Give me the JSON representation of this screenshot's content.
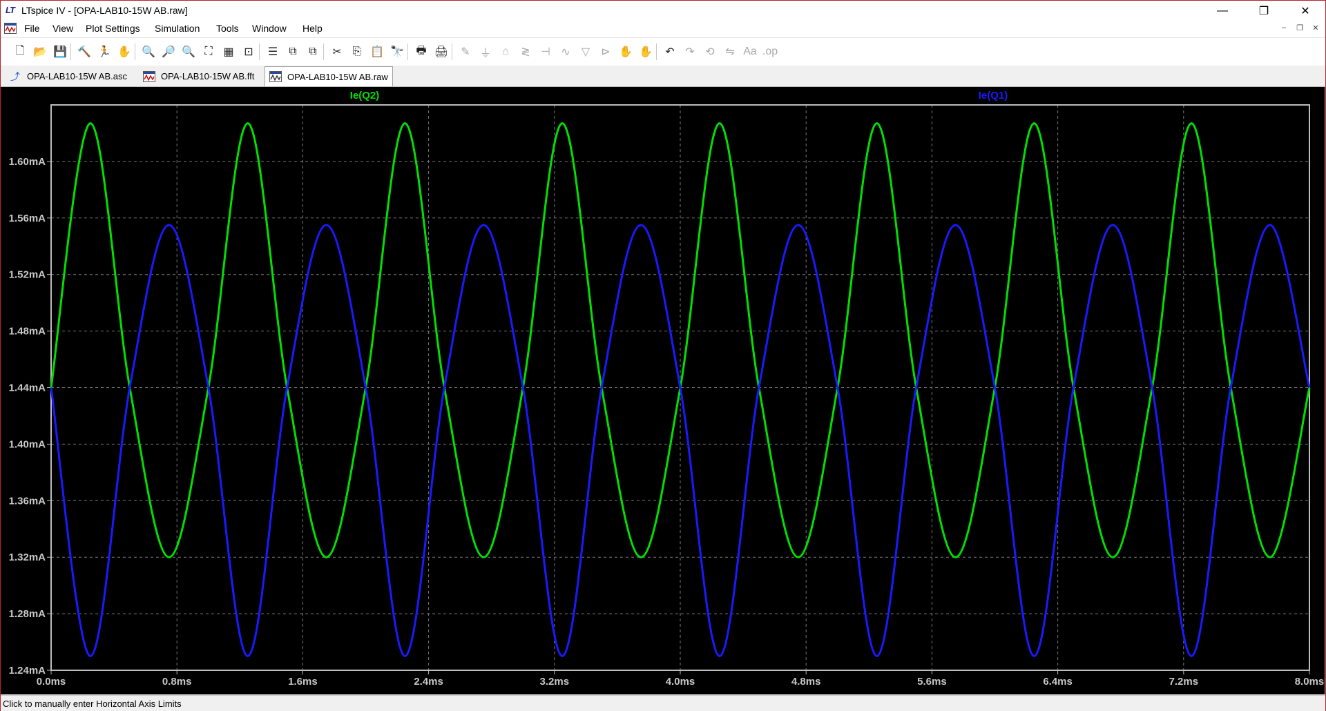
{
  "window": {
    "app_mark": "LT",
    "title": "LTspice IV - [OPA-LAB10-15W AB.raw]",
    "minimize": "—",
    "maximize": "❐",
    "close": "✕"
  },
  "menu": {
    "items": [
      "File",
      "View",
      "Plot Settings",
      "Simulation",
      "Tools",
      "Window",
      "Help"
    ],
    "mdi_minimize": "–",
    "mdi_restore": "❐",
    "mdi_close": "✕"
  },
  "toolbar": {
    "buttons": [
      {
        "name": "new-schematic-icon",
        "glyph": "🗋",
        "enabled": true
      },
      {
        "name": "open-icon",
        "glyph": "📂",
        "enabled": true
      },
      {
        "name": "save-icon",
        "glyph": "💾",
        "enabled": true
      },
      {
        "name": "control-panel-icon",
        "glyph": "🔨",
        "enabled": true
      },
      {
        "name": "run-icon",
        "glyph": "🏃",
        "enabled": true
      },
      {
        "name": "pan-icon",
        "glyph": "✋",
        "enabled": false
      },
      {
        "name": "zoom-in-icon",
        "glyph": "🔍",
        "enabled": true
      },
      {
        "name": "zoom-area-icon",
        "glyph": "🔎",
        "enabled": true
      },
      {
        "name": "zoom-out-icon",
        "glyph": "🔍",
        "enabled": true
      },
      {
        "name": "zoom-fit-icon",
        "glyph": "⛶",
        "enabled": true
      },
      {
        "name": "autorange-icon",
        "glyph": "▦",
        "enabled": true
      },
      {
        "name": "fit-icon",
        "glyph": "⊡",
        "enabled": true
      },
      {
        "name": "tile-horizontal-icon",
        "glyph": "☰",
        "enabled": true
      },
      {
        "name": "cascade-icon",
        "glyph": "⧉",
        "enabled": true
      },
      {
        "name": "tile-vertical-icon",
        "glyph": "⧉",
        "enabled": true
      },
      {
        "name": "cut-icon",
        "glyph": "✂",
        "enabled": true
      },
      {
        "name": "copy-icon",
        "glyph": "⎘",
        "enabled": true
      },
      {
        "name": "paste-icon",
        "glyph": "📋",
        "enabled": true
      },
      {
        "name": "find-icon",
        "glyph": "🔭",
        "enabled": true
      },
      {
        "name": "print-setup-icon",
        "glyph": "🖶",
        "enabled": true
      },
      {
        "name": "print-icon",
        "glyph": "🖨",
        "enabled": true
      },
      {
        "name": "wire-icon",
        "glyph": "✎",
        "enabled": false
      },
      {
        "name": "ground-icon",
        "glyph": "⏚",
        "enabled": false
      },
      {
        "name": "label-net-icon",
        "glyph": "⌂",
        "enabled": false
      },
      {
        "name": "resistor-icon",
        "glyph": "≷",
        "enabled": false
      },
      {
        "name": "capacitor-icon",
        "glyph": "⊣",
        "enabled": false
      },
      {
        "name": "inductor-icon",
        "glyph": "∿",
        "enabled": false
      },
      {
        "name": "diode-icon",
        "glyph": "▽",
        "enabled": false
      },
      {
        "name": "component-icon",
        "glyph": "⊳",
        "enabled": false
      },
      {
        "name": "move-icon",
        "glyph": "✋",
        "enabled": false
      },
      {
        "name": "drag-icon",
        "glyph": "✋",
        "enabled": false
      },
      {
        "name": "undo-icon",
        "glyph": "↶",
        "enabled": true
      },
      {
        "name": "redo-icon",
        "glyph": "↷",
        "enabled": false
      },
      {
        "name": "rotate-icon",
        "glyph": "⟲",
        "enabled": false
      },
      {
        "name": "mirror-icon",
        "glyph": "⇋",
        "enabled": false
      },
      {
        "name": "text-icon",
        "glyph": "Aa",
        "enabled": false
      },
      {
        "name": "spice-directive-icon",
        "glyph": ".op",
        "enabled": false
      }
    ]
  },
  "tabs": [
    {
      "label": "OPA-LAB10-15W AB.asc",
      "icon": "schematic-icon",
      "active": false
    },
    {
      "label": "OPA-LAB10-15W AB.fft",
      "icon": "waveform-icon",
      "active": false
    },
    {
      "label": "OPA-LAB10-15W AB.raw",
      "icon": "waveform-icon",
      "active": true
    }
  ],
  "chart_data": {
    "type": "line",
    "title": "",
    "xlabel": "",
    "ylabel": "",
    "xlim": [
      0,
      8.0
    ],
    "ylim": [
      1.24,
      1.64
    ],
    "x_ticks": [
      "0.0ms",
      "0.8ms",
      "1.6ms",
      "2.4ms",
      "3.2ms",
      "4.0ms",
      "4.8ms",
      "5.6ms",
      "6.4ms",
      "7.2ms",
      "8.0ms"
    ],
    "y_ticks": [
      "1.24mA",
      "1.28mA",
      "1.32mA",
      "1.36mA",
      "1.40mA",
      "1.44mA",
      "1.48mA",
      "1.52mA",
      "1.56mA",
      "1.60mA"
    ],
    "grid": true,
    "background": "#000000",
    "series": [
      {
        "name": "Ie(Q2)",
        "color": "#00e000",
        "x": [
          0.0,
          0.25,
          0.5,
          0.75,
          1.0,
          1.25,
          1.5,
          1.75,
          2.0,
          2.25,
          2.5,
          2.75,
          3.0,
          3.25,
          3.5,
          3.75,
          4.0,
          4.25,
          4.5,
          4.75,
          5.0,
          5.25,
          5.5,
          5.75,
          6.0,
          6.25,
          6.5,
          6.75,
          7.0,
          7.25,
          7.5,
          7.75,
          8.0
        ],
        "y": [
          1.44,
          1.627,
          1.44,
          1.32,
          1.44,
          1.627,
          1.44,
          1.32,
          1.44,
          1.627,
          1.44,
          1.32,
          1.44,
          1.627,
          1.44,
          1.32,
          1.44,
          1.627,
          1.44,
          1.32,
          1.44,
          1.627,
          1.44,
          1.32,
          1.44,
          1.627,
          1.44,
          1.32,
          1.44,
          1.627,
          1.44,
          1.32,
          1.44
        ]
      },
      {
        "name": "Ie(Q1)",
        "color": "#1a1aff",
        "x": [
          0.0,
          0.25,
          0.5,
          0.75,
          1.0,
          1.25,
          1.5,
          1.75,
          2.0,
          2.25,
          2.5,
          2.75,
          3.0,
          3.25,
          3.5,
          3.75,
          4.0,
          4.25,
          4.5,
          4.75,
          5.0,
          5.25,
          5.5,
          5.75,
          6.0,
          6.25,
          6.5,
          6.75,
          7.0,
          7.25,
          7.5,
          7.75,
          8.0
        ],
        "y": [
          1.44,
          1.25,
          1.44,
          1.555,
          1.44,
          1.25,
          1.44,
          1.555,
          1.44,
          1.25,
          1.44,
          1.555,
          1.44,
          1.25,
          1.44,
          1.555,
          1.44,
          1.25,
          1.44,
          1.555,
          1.44,
          1.25,
          1.44,
          1.555,
          1.44,
          1.25,
          1.44,
          1.555,
          1.44,
          1.25,
          1.44,
          1.555,
          1.44
        ]
      }
    ]
  },
  "status": {
    "text": "Click to manually enter Horizontal Axis Limits"
  }
}
